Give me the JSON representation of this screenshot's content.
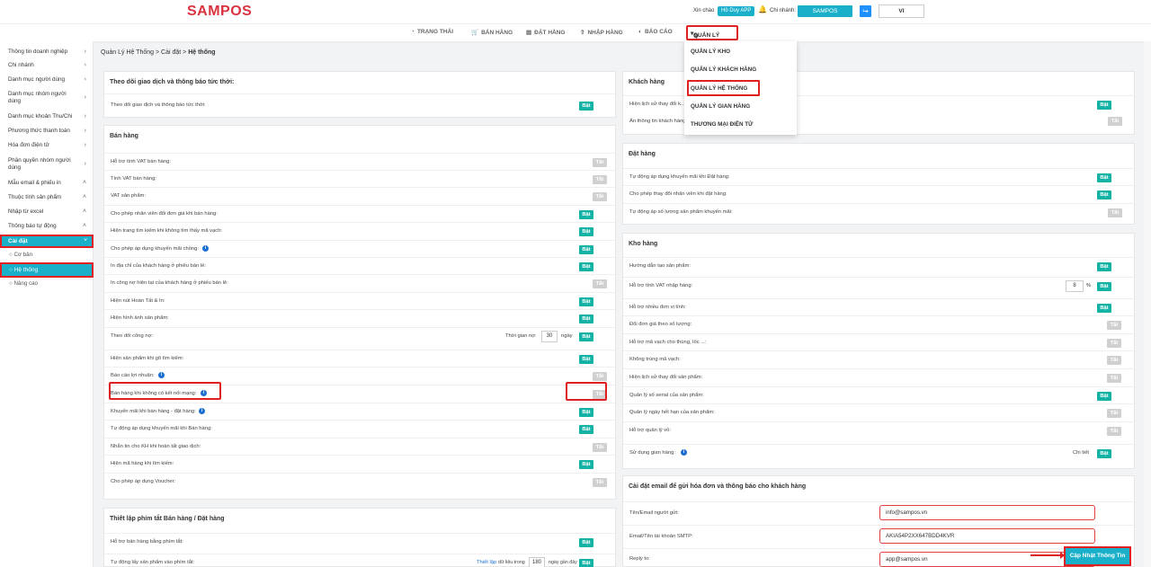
{
  "header": {
    "logo": "SAMPOS",
    "greeting": "Xin chào",
    "user": "Hồ Duy APP",
    "branch_label": "Chi nhánh:",
    "branch": "SAMPOS",
    "language": "VI"
  },
  "nav": {
    "items": [
      "TRẠNG THÁI",
      "BÁN HÀNG",
      "ĐẶT HÀNG",
      "NHẬP HÀNG",
      "BÁO CÁO",
      "QUẢN LÝ"
    ],
    "dropdown": [
      "QUẢN LÝ KHO",
      "QUẢN LÝ KHÁCH HÀNG",
      "QUẢN LÝ HỆ THỐNG",
      "QUẢN LÝ GIAN HÀNG",
      "THƯƠNG MẠI ĐIỆN TỬ"
    ]
  },
  "sidebar": {
    "items": [
      "Thông tin doanh nghiệp",
      "Chi nhánh",
      "Danh mục người dùng",
      "Danh mục nhóm người dùng",
      "Danh mục khoản Thu/Chi",
      "Phương thức thanh toán",
      "Hóa đơn điện tử",
      "Phân quyền nhóm người dùng",
      "Mẫu email & phiếu in",
      "Thuộc tính sản phẩm",
      "Nhập từ excel",
      "Thông báo tự động",
      "Cài đặt"
    ],
    "sub": [
      "Cơ bản",
      "Hệ thống",
      "Nâng cao"
    ]
  },
  "breadcrumb": {
    "a": "Quản Lý Hệ Thống",
    "b": "Cài đặt",
    "c": "Hệ thống"
  },
  "toggle": {
    "on": "Bật",
    "off": "Tắt"
  },
  "left": {
    "p1": {
      "title": "Theo dõi giao dịch và thông báo tức thời:",
      "rows": [
        "Theo dõi giao dịch và thông báo tức thời:"
      ]
    },
    "p2": {
      "title": "Bán hàng",
      "rows": [
        "Hỗ trợ tính VAT bán hàng:",
        "Tính VAT bán hàng:",
        "VAT sản phẩm:",
        "Cho phép nhân viên đổi đơn giá khi bán hàng:",
        "Hiện trang tìm kiếm khi không tìm thấy mã vạch:",
        "Cho phép áp dụng khuyến mãi chồng:",
        "In địa chỉ của khách hàng ở phiếu bán lẻ:",
        "In công nợ hiện tại của khách hàng ở phiếu bán lẻ:",
        "Hiện nút Hoàn Tất & In:",
        "Hiện hình ảnh sản phẩm:",
        "Theo dõi công nợ:",
        "Hiện sản phẩm khi gõ tìm kiếm:",
        "Báo cáo lợi nhuận:",
        "Bán hàng khi không có kết nối mạng:",
        "Khuyến mãi khi bán hàng - đặt hàng:",
        "Tự động áp dụng khuyến mãi khi Bán hàng:",
        "Nhắn tin cho KH khi hoàn tất giao dịch:",
        "Hiện mã hàng khi tìm kiếm:",
        "Cho phép áp dụng Voucher:"
      ],
      "debt_time": "Thời gian nợ:",
      "debt_days": "30",
      "days": "ngày"
    },
    "p3": {
      "title": "Thiết lập phím tắt Bán hàng / Đặt hàng",
      "rows": [
        "Hỗ trợ bán hàng bằng phím tắt:",
        "Tự động lấy sản phẩm vào phím tắt:"
      ],
      "setup": "Thiết lập",
      "data_from": "dữ liệu trong",
      "n": "180",
      "recent": "ngày gần đây"
    }
  },
  "right": {
    "customer": {
      "title": "Khách hàng",
      "rows": [
        "Hiện lịch sử thay đổi k...",
        "Ẩn thông tin khách hàng"
      ]
    },
    "order": {
      "title": "Đặt hàng",
      "rows": [
        "Tự động áp dụng khuyến mãi khi Đặt hàng:",
        "Cho phép thay đổi nhân viên khi đặt hàng:",
        "Tự động áp số lượng sản phẩm khuyến mãi:"
      ]
    },
    "stock": {
      "title": "Kho hàng",
      "rows": [
        "Hướng dẫn tạo sản phẩm:",
        "Hỗ trợ tính VAT nhập hàng:",
        "Hỗ trợ nhiều đơn vị tính:",
        "Đổi đơn giá theo số lượng:",
        "Hỗ trợ mã vạch cho thùng, lốc ...:",
        "Không trùng mã vạch:",
        "Hiện lịch sử thay đổi sản phẩm:",
        "Quản lý số serial của sản phẩm:",
        "Quản lý ngày hết hạn của sản phẩm:",
        "Hỗ trợ quản lý vỏ:",
        "Sử dụng gian hàng:"
      ],
      "vat_value": "8",
      "pct": "%",
      "detail": "Chi tiết"
    },
    "email": {
      "title": "Cài đặt email để gửi hóa đơn và thông báo cho khách hàng",
      "rows": [
        "Tên/Email người gửi:",
        "Email/Tên tài khoản SMTP:",
        "Reply to:"
      ],
      "values": [
        "info@sampos.vn",
        "AKIA54P2XX647BDD4KVR",
        "app@sampos.vn"
      ],
      "button": "Cập Nhật Thông Tin"
    }
  }
}
